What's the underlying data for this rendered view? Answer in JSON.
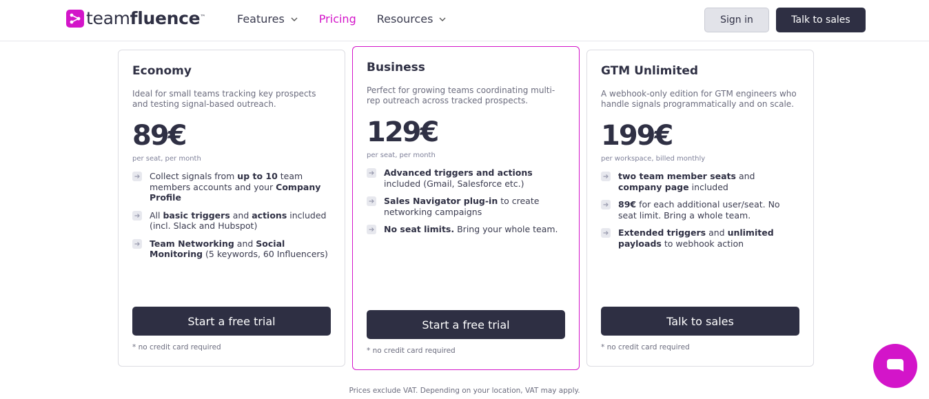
{
  "brand": {
    "name_light": "team",
    "name_bold": "fluence",
    "tm": "™"
  },
  "nav": {
    "items": [
      {
        "label": "Features",
        "has_dropdown": true,
        "active": false
      },
      {
        "label": "Pricing",
        "has_dropdown": false,
        "active": true
      },
      {
        "label": "Resources",
        "has_dropdown": true,
        "active": false
      }
    ]
  },
  "header": {
    "signin_label": "Sign in",
    "talk_label": "Talk to sales"
  },
  "plans": [
    {
      "name": "Economy",
      "description": "Ideal for small teams tracking key prospects and testing signal-based outreach.",
      "price": "89€",
      "period": "per seat, per month",
      "features": [
        [
          {
            "t": "Collect signals from "
          },
          {
            "t": "up to 10",
            "b": true
          },
          {
            "t": " team members accounts and your "
          },
          {
            "t": "Company Profile",
            "b": true
          }
        ],
        [
          {
            "t": "All "
          },
          {
            "t": "basic triggers",
            "b": true
          },
          {
            "t": " and "
          },
          {
            "t": "actions",
            "b": true
          },
          {
            "t": " included (incl. Slack and Hubspot)"
          }
        ],
        [
          {
            "t": "Team Networking",
            "b": true
          },
          {
            "t": " and "
          },
          {
            "t": "Social Monitoring",
            "b": true
          },
          {
            "t": " (5 keywords, 60 Influencers)"
          }
        ]
      ],
      "cta": "Start a free trial",
      "note": "* no credit card required"
    },
    {
      "name": "Business",
      "description": "Perfect for growing teams coordinating multi-rep outreach across tracked prospects.",
      "price": "129€",
      "period": "per seat, per month",
      "features": [
        [
          {
            "t": "Advanced triggers and actions",
            "b": true
          },
          {
            "t": " included (Gmail, Salesforce etc.)"
          }
        ],
        [
          {
            "t": "Sales Navigator plug-in",
            "b": true
          },
          {
            "t": " to create networking campaigns"
          }
        ],
        [
          {
            "t": "No seat limits.",
            "b": true
          },
          {
            "t": " Bring your whole team."
          }
        ]
      ],
      "cta": "Start a free trial",
      "note": "* no credit card required"
    },
    {
      "name": "GTM Unlimited",
      "description": "A webhook-only edition for GTM engineers who handle signals programmatically and on scale.",
      "price": "199€",
      "period": "per workspace, billed monthly",
      "features": [
        [
          {
            "t": "two team member seats",
            "b": true
          },
          {
            "t": " and "
          },
          {
            "t": "company page",
            "b": true
          },
          {
            "t": " included"
          }
        ],
        [
          {
            "t": "89€",
            "b": true
          },
          {
            "t": " for each additional user/seat. No seat limit. Bring a whole team."
          }
        ],
        [
          {
            "t": "Extended triggers",
            "b": true
          },
          {
            "t": " and "
          },
          {
            "t": "unlimited payloads",
            "b": true
          },
          {
            "t": " to webhook action"
          }
        ]
      ],
      "cta": "Talk to sales",
      "note": "* no credit card required"
    }
  ],
  "footer_note": "Prices exclude VAT. Depending on your location, VAT may apply.",
  "icons": {
    "logo": "teamfluence-logo-icon",
    "dropdown": "chevron-down-icon",
    "feature": "arrow-right-icon",
    "chat": "chat-bubble-icon"
  },
  "colors": {
    "accent": "#d315c9",
    "dark": "#2e2f43",
    "border": "#dcdce2"
  }
}
